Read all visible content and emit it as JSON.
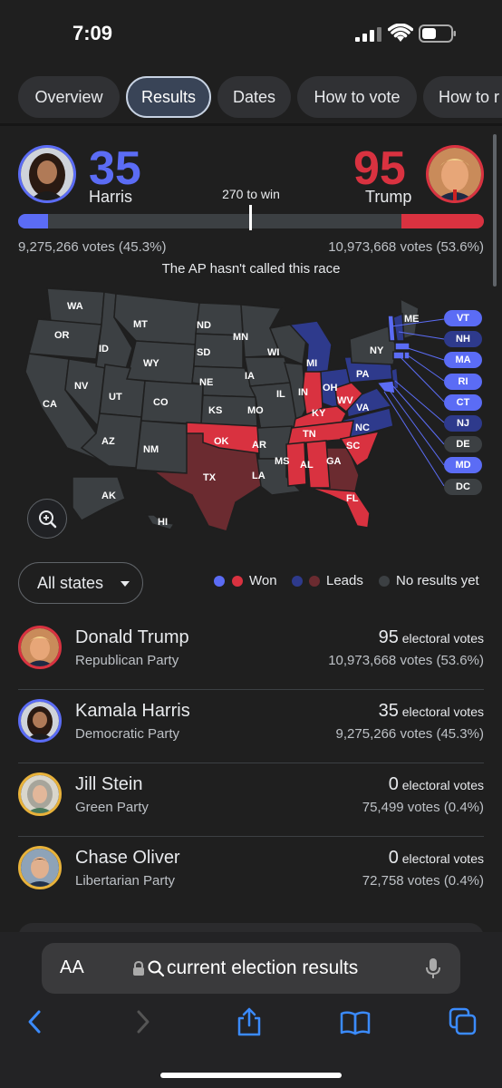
{
  "status_bar": {
    "time": "7:09"
  },
  "tabs": [
    {
      "label": "Overview"
    },
    {
      "label": "Results"
    },
    {
      "label": "Dates"
    },
    {
      "label": "How to vote"
    },
    {
      "label": "How to r"
    }
  ],
  "scoreboard": {
    "harris": {
      "electoral": "35",
      "name": "Harris",
      "votes": "9,275,266 votes (45.3%)"
    },
    "trump": {
      "electoral": "95",
      "name": "Trump",
      "votes": "10,973,668 votes (53.6%)"
    },
    "to_win": "270 to win",
    "status": "The AP hasn't called this race",
    "progress": {
      "harris_ev": 35,
      "trump_ev": 95,
      "total_ev": 538
    },
    "colors": {
      "dem": "#5b6cf5",
      "rep": "#d93240",
      "dem_leads": "#2e3a8c",
      "rep_leads": "#6b2b30",
      "none": "#3c4043"
    }
  },
  "map": {
    "labels": [
      "WA",
      "OR",
      "CA",
      "ID",
      "NV",
      "MT",
      "WY",
      "UT",
      "AZ",
      "CO",
      "NM",
      "ND",
      "SD",
      "NE",
      "KS",
      "OK",
      "TX",
      "MN",
      "IA",
      "MO",
      "AR",
      "LA",
      "WI",
      "IL",
      "MI",
      "IN",
      "OH",
      "KY",
      "TN",
      "MS",
      "AL",
      "GA",
      "FL",
      "SC",
      "NC",
      "VA",
      "WV",
      "PA",
      "NY",
      "ME",
      "AK",
      "HI"
    ],
    "northeast": [
      {
        "label": "VT",
        "status": "dem_won"
      },
      {
        "label": "NH",
        "status": "dem_leads"
      },
      {
        "label": "MA",
        "status": "dem_won"
      },
      {
        "label": "RI",
        "status": "dem_won"
      },
      {
        "label": "CT",
        "status": "dem_won"
      },
      {
        "label": "NJ",
        "status": "dem_leads"
      },
      {
        "label": "DE",
        "status": "none"
      },
      {
        "label": "MD",
        "status": "dem_won"
      },
      {
        "label": "DC",
        "status": "none"
      }
    ]
  },
  "filter": {
    "label": "All states"
  },
  "legend": {
    "won": "Won",
    "leads": "Leads",
    "none": "No results yet"
  },
  "candidates": [
    {
      "name": "Donald Trump",
      "party": "Republican Party",
      "electoral": "95",
      "electoral_label": "electoral votes",
      "votes": "10,973,668 votes (53.6%)",
      "ring": "#d93240"
    },
    {
      "name": "Kamala Harris",
      "party": "Democratic Party",
      "electoral": "35",
      "electoral_label": "electoral votes",
      "votes": "9,275,266 votes (45.3%)",
      "ring": "#5b6cf5"
    },
    {
      "name": "Jill Stein",
      "party": "Green Party",
      "electoral": "0",
      "electoral_label": "electoral votes",
      "votes": "75,499 votes (0.4%)",
      "ring": "#e8b23a"
    },
    {
      "name": "Chase Oliver",
      "party": "Libertarian Party",
      "electoral": "0",
      "electoral_label": "electoral votes",
      "votes": "72,758 votes (0.4%)",
      "ring": "#e8b23a"
    }
  ],
  "browser": {
    "aa_label": "AA",
    "url": "current election results"
  }
}
